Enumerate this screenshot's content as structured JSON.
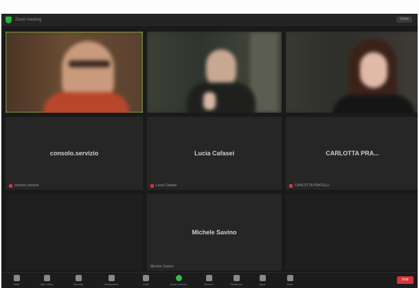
{
  "meeting": {
    "title": "Zoom meeting",
    "security_icon": "shield-icon",
    "view_label": "View",
    "accent_color": "#7fb84a"
  },
  "participants": [
    {
      "name": "",
      "video": true,
      "label": "",
      "muted": true
    },
    {
      "name": "",
      "video": true,
      "label": "",
      "muted": false
    },
    {
      "name": "",
      "video": true,
      "label": "",
      "muted": false
    },
    {
      "name": "consolo.servizio",
      "video": false,
      "label": "consolo servizio",
      "muted": true
    },
    {
      "name": "Lucia Cafasei",
      "video": false,
      "label": "Lucia Cafasei",
      "muted": true
    },
    {
      "name": "CARLOTTA PRA...",
      "video": false,
      "label": "CARLOTTA PRATELLI",
      "muted": true
    },
    {
      "name": "Michele Savino",
      "video": false,
      "label": "Michele Savino",
      "muted": false
    }
  ],
  "toolbar": {
    "items": [
      {
        "label": "Mute",
        "icon": "microphone-icon"
      },
      {
        "label": "Stop Video",
        "icon": "camera-icon"
      },
      {
        "label": "Security",
        "icon": "shield-icon"
      },
      {
        "label": "Participants",
        "icon": "people-icon"
      },
      {
        "label": "Chat",
        "icon": "chat-icon"
      },
      {
        "label": "Share Screen",
        "icon": "share-screen-icon"
      },
      {
        "label": "Record",
        "icon": "record-icon"
      },
      {
        "label": "Reactions",
        "icon": "emoji-icon"
      },
      {
        "label": "Apps",
        "icon": "apps-icon"
      },
      {
        "label": "More",
        "icon": "more-icon"
      }
    ],
    "end_label": "End"
  }
}
